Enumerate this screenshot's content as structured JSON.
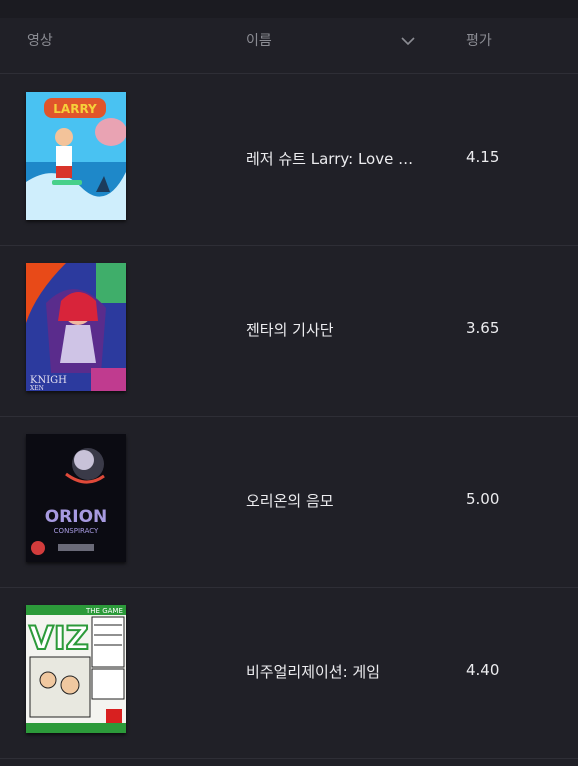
{
  "header": {
    "video_label": "영상",
    "name_label": "이름",
    "rating_label": "평가",
    "sort_icon": "chevron-down-icon"
  },
  "games": [
    {
      "name": "레저 슈트 Larry: Love for Sail!",
      "rating": "4.15",
      "cover_text": "LARRY",
      "cover_colors": [
        "#2ab5f0",
        "#d93d2a",
        "#f2c230"
      ]
    },
    {
      "name": "젠타의 기사단",
      "rating": "3.65",
      "cover_text": "KNIGHTS XENTAR",
      "cover_colors": [
        "#2d3fb0",
        "#e8381a",
        "#c03b8f"
      ]
    },
    {
      "name": "오리온의 음모",
      "rating": "5.00",
      "cover_text": "ORION CONSPIRACY",
      "cover_colors": [
        "#0a0a10",
        "#9a8cd8",
        "#d23c3c"
      ]
    },
    {
      "name": "비주얼리제이션: 게임",
      "rating": "4.40",
      "cover_text": "VIZ THE GAME",
      "cover_colors": [
        "#ffffff",
        "#2c9a3a",
        "#d82020"
      ]
    }
  ]
}
